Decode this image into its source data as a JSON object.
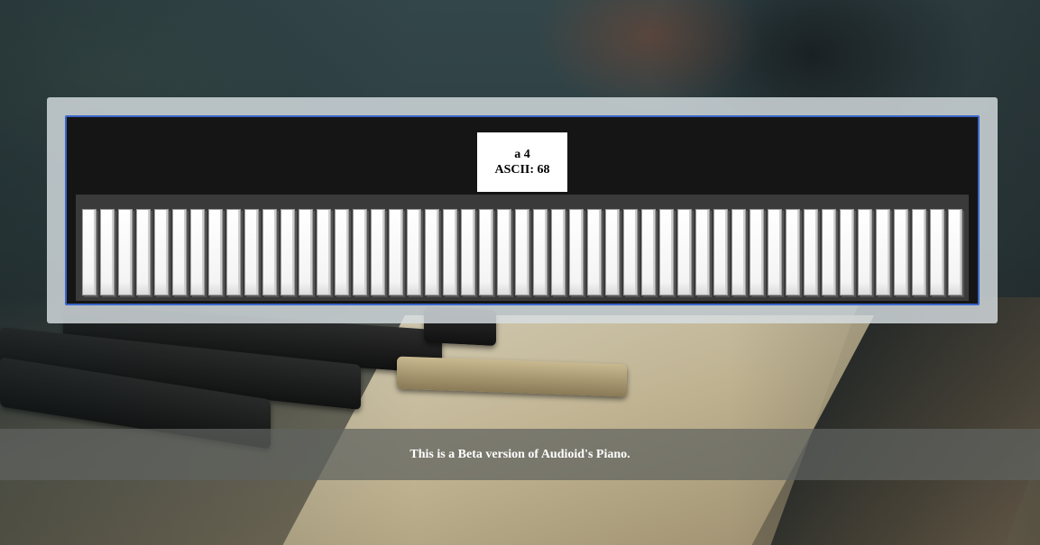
{
  "note_display": {
    "note": "a 4",
    "ascii": "ASCII: 68"
  },
  "piano": {
    "white_key_count": 49
  },
  "banner": {
    "text": "This is a Beta version of Audioid's Piano."
  },
  "colors": {
    "frame_border": "#3a66c8",
    "piano_bg": "#151515",
    "keybed": "#3a3a3a",
    "panel": "#d7dee2"
  }
}
